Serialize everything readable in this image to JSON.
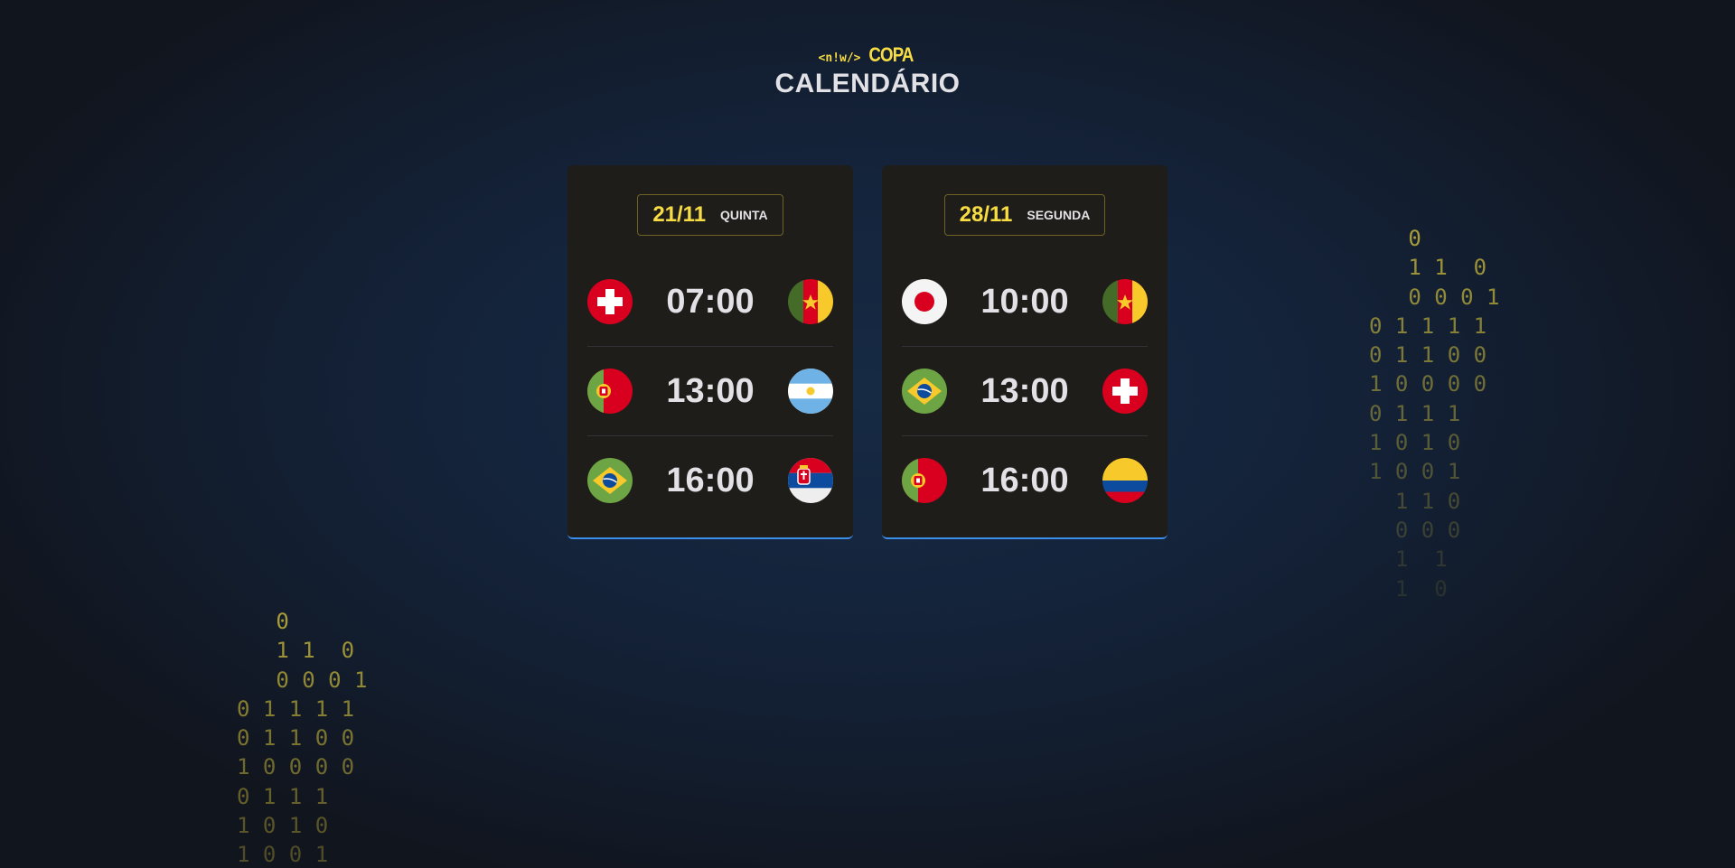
{
  "header": {
    "logo_tag": "<n!w/>",
    "logo_text": "COPA",
    "title": "CALENDÁRIO"
  },
  "colors": {
    "accent_yellow": "#f7dd43",
    "card_bg": "#1f1d19",
    "card_border_bottom": "#3b8eea",
    "text": "#e1e1e6"
  },
  "cards": [
    {
      "date": "21/11",
      "weekday": "QUINTA",
      "games": [
        {
          "home": "switzerland-flag-icon",
          "time": "07:00",
          "away": "cameroon-flag-icon"
        },
        {
          "home": "portugal-flag-icon",
          "time": "13:00",
          "away": "argentina-flag-icon"
        },
        {
          "home": "brazil-flag-icon",
          "time": "16:00",
          "away": "serbia-flag-icon"
        }
      ]
    },
    {
      "date": "28/11",
      "weekday": "SEGUNDA",
      "games": [
        {
          "home": "japan-flag-icon",
          "time": "10:00",
          "away": "cameroon-flag-icon"
        },
        {
          "home": "brazil-flag-icon",
          "time": "13:00",
          "away": "switzerland-flag-icon"
        },
        {
          "home": "portugal-flag-icon",
          "time": "16:00",
          "away": "colombia-flag-icon"
        }
      ]
    }
  ],
  "binary_rain": {
    "right": [
      "   0",
      "   1 1  0",
      "   0 0 0 1",
      "0 1 1 1 1",
      "0 1 1 0 0",
      "1 0 0 0 0",
      "0 1 1 1",
      "1 0 1 0",
      "1 0 0 1",
      "  1 1 0",
      "  0 0 0",
      "  1  1",
      "  1  0"
    ],
    "left": [
      "   0",
      "   1 1  0",
      "   0 0 0 1",
      "0 1 1 1 1",
      "0 1 1 0 0",
      "1 0 0 0 0",
      "0 1 1 1",
      "1 0 1 0",
      "1 0 0 1"
    ]
  }
}
